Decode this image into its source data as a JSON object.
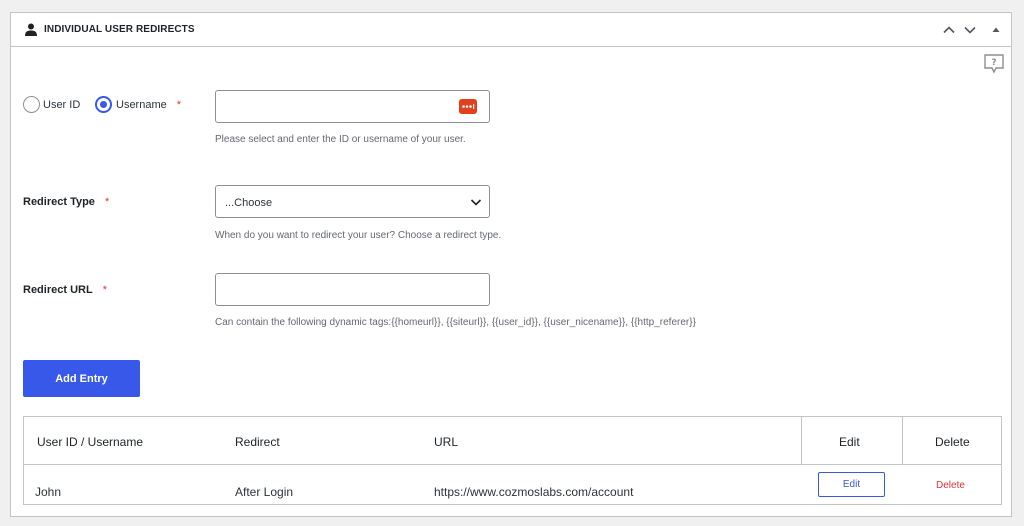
{
  "panel": {
    "title": "INDIVIDUAL USER REDIRECTS",
    "icons": {
      "header": "user-icon",
      "collapse_up": "chevron-up-icon",
      "collapse_down": "chevron-down-icon",
      "toggle": "triangle-up-icon",
      "help": "help-question-icon"
    }
  },
  "form": {
    "user_field": {
      "options": [
        {
          "label": "User ID",
          "checked": false
        },
        {
          "label": "Username",
          "checked": true
        }
      ],
      "required_mark": "*",
      "value": "",
      "placeholder": "",
      "hint": "Please select and enter the ID or username of your user."
    },
    "redirect_type": {
      "label": "Redirect Type",
      "required_mark": "*",
      "selected": "...Choose",
      "hint": "When do you want to redirect your user? Choose a redirect type."
    },
    "redirect_url": {
      "label": "Redirect URL",
      "required_mark": "*",
      "value": "",
      "placeholder": "",
      "hint": "Can contain the following dynamic tags:{{homeurl}}, {{siteurl}}, {{user_id}}, {{user_nicename}}, {{http_referer}}"
    },
    "add_button": "Add Entry"
  },
  "table": {
    "columns": [
      "User ID / Username",
      "Redirect",
      "URL",
      "Edit",
      "Delete"
    ],
    "rows": [
      {
        "user": "John",
        "redirect": "After Login",
        "url": "https://www.cozmoslabs.com/account",
        "edit": "Edit",
        "delete": "Delete"
      }
    ]
  },
  "colors": {
    "accent": "#3858e9",
    "danger": "#d63638",
    "password_badge": "#e2401c"
  }
}
